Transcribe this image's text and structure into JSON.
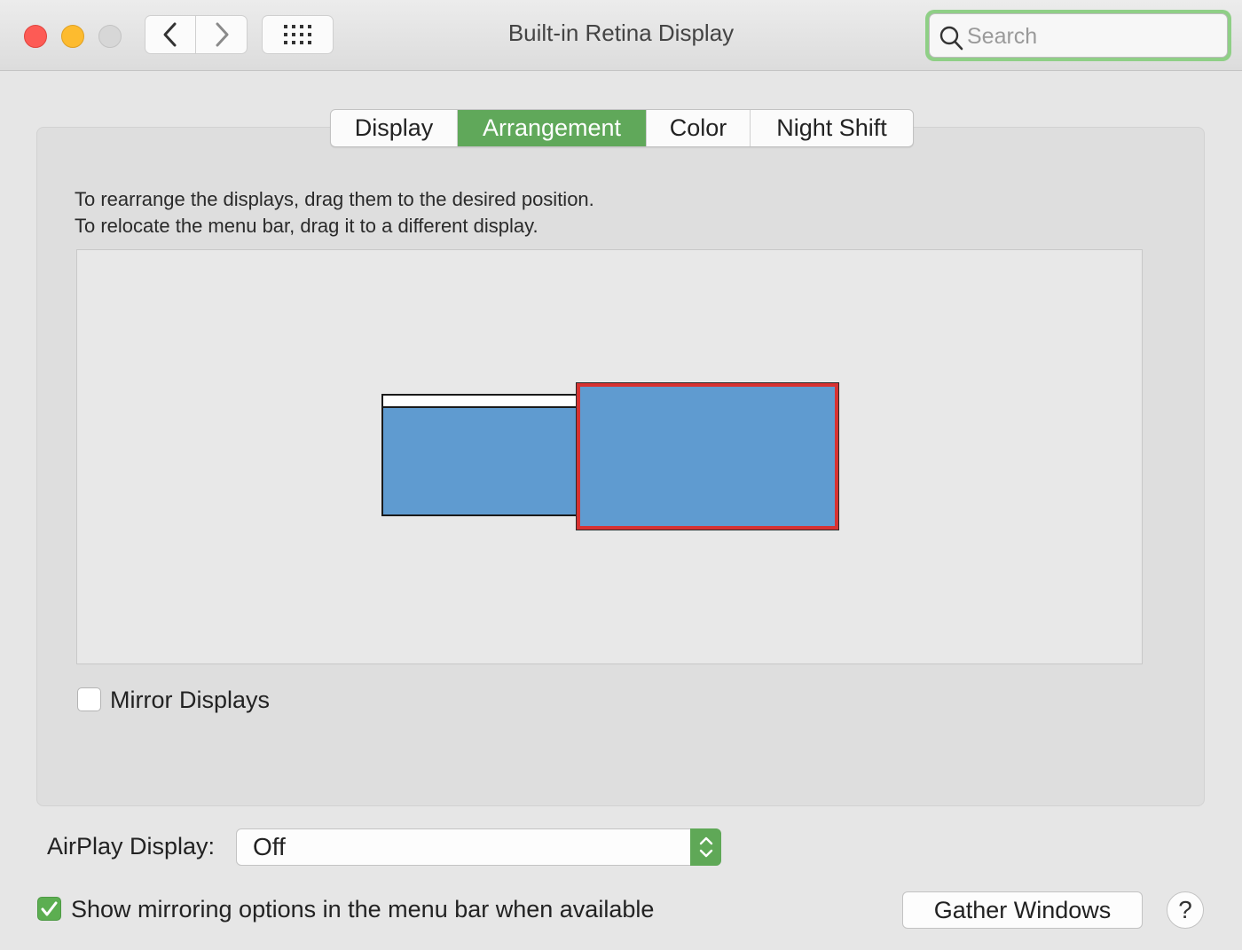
{
  "window": {
    "title": "Built-in Retina Display"
  },
  "toolbar": {
    "back_icon": "chevron-left-icon",
    "forward_icon": "chevron-right-icon",
    "grid_icon": "grid-icon"
  },
  "search": {
    "placeholder": "Search",
    "value": ""
  },
  "tabs": [
    {
      "label": "Display",
      "active": false
    },
    {
      "label": "Arrangement",
      "active": true
    },
    {
      "label": "Color",
      "active": false
    },
    {
      "label": "Night Shift",
      "active": false
    }
  ],
  "instructions": {
    "line1": "To rearrange the displays, drag them to the desired position.",
    "line2": "To relocate the menu bar, drag it to a different display."
  },
  "displays": [
    {
      "name": "display-left",
      "has_menu_bar": true,
      "selected": false
    },
    {
      "name": "display-right",
      "has_menu_bar": false,
      "selected": true
    }
  ],
  "mirror": {
    "label": "Mirror Displays",
    "checked": false
  },
  "airplay": {
    "label": "AirPlay Display:",
    "value": "Off"
  },
  "show_mirroring": {
    "label": "Show mirroring options in the menu bar when available",
    "checked": true
  },
  "buttons": {
    "gather": "Gather Windows",
    "help": "?"
  },
  "colors": {
    "accent": "#60a85a",
    "display_fill": "#5f9bd0",
    "selection_border": "#d63232"
  }
}
